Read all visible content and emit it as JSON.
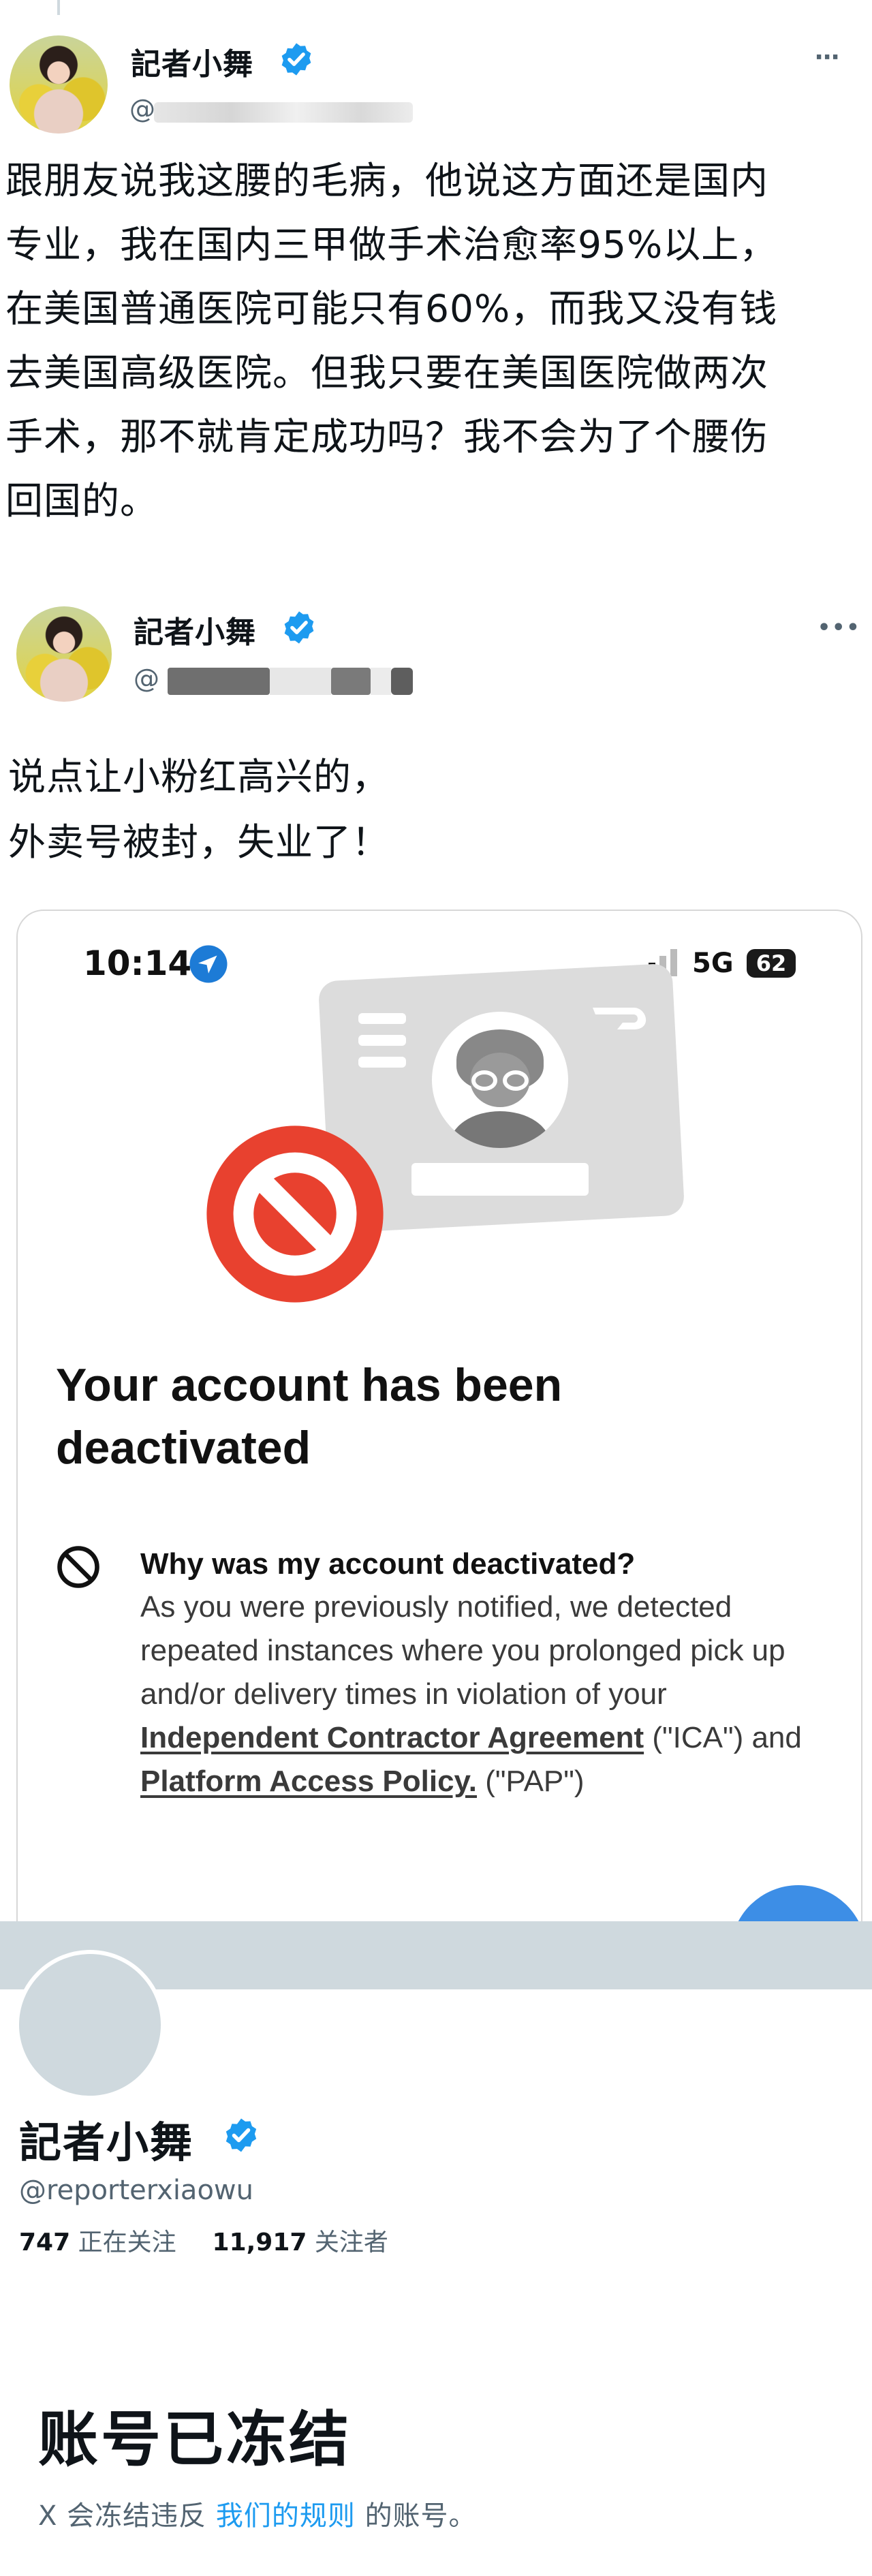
{
  "tweet1": {
    "author_name": "記者小舞",
    "handle_prefix": "@",
    "text": "跟朋友说我这腰的毛病，他说这方面还是国内\n专业，我在国内三甲做手术治愈率95%以上，\n在美国普通医院可能只有60%，而我又没有钱\n去美国高级医院。但我只要在美国医院做两次\n手术，那不就肯定成功吗？我不会为了个腰伤\n回国的。",
    "more_icon": "more-dots-icon"
  },
  "tweet2": {
    "author_name": "記者小舞",
    "handle_prefix": "@",
    "more_label": "•••",
    "text": "说点让小粉红高兴的，\n外卖号被封，失业了！"
  },
  "phone": {
    "time": "10:14",
    "network": "5G",
    "battery": "62",
    "title": "Your account has been deactivated",
    "title_line1": "Your account has been",
    "title_line2": "deactivated",
    "why_title": "Why was my account deactivated?",
    "why_body_1": "As you were previously notified, we detected repeated instances where you prolonged pick up and/or delivery times in violation of your ",
    "link_ica": "Independent Contractor Agreement",
    "why_body_2": " (\"ICA\") and ",
    "link_pap": "Platform Access Policy.",
    "why_body_3": " (\"PAP\")",
    "colors": {
      "brand_red": "#e8412f",
      "location_blue": "#1d7bd6"
    }
  },
  "profile": {
    "name": "記者小舞",
    "handle": "@reporterxiaowu",
    "following_count": "747",
    "following_label": "正在关注",
    "followers_count": "11,917",
    "followers_label": "关注者",
    "frozen_title": "账号已冻结",
    "frozen_sub_pre": "X 会冻结违反",
    "frozen_sub_link": "我们的规则",
    "frozen_sub_post": "的账号。"
  },
  "colors": {
    "verified_blue": "#1d9bf0",
    "text": "#0f1419",
    "muted": "#536471"
  }
}
